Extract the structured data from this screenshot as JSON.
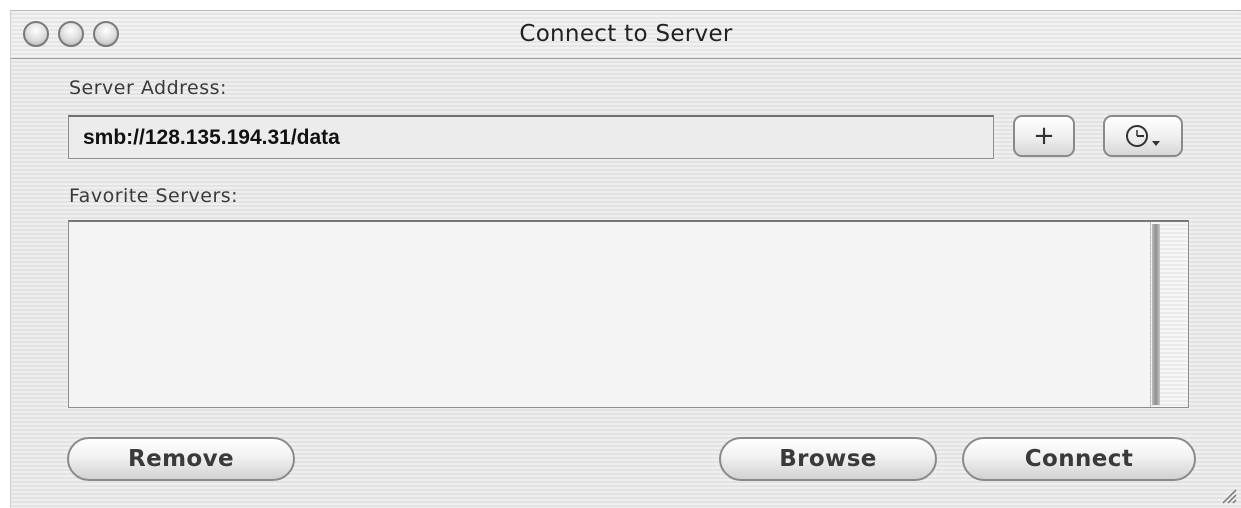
{
  "window": {
    "title": "Connect to Server"
  },
  "server_address": {
    "label": "Server Address:",
    "value": "smb://128.135.194.31/data"
  },
  "buttons": {
    "add_favorite_label": "+",
    "recent_servers_icon": "clock-icon"
  },
  "favorites": {
    "label": "Favorite Servers:",
    "items": []
  },
  "footer": {
    "remove_label": "Remove",
    "browse_label": "Browse",
    "connect_label": "Connect"
  }
}
